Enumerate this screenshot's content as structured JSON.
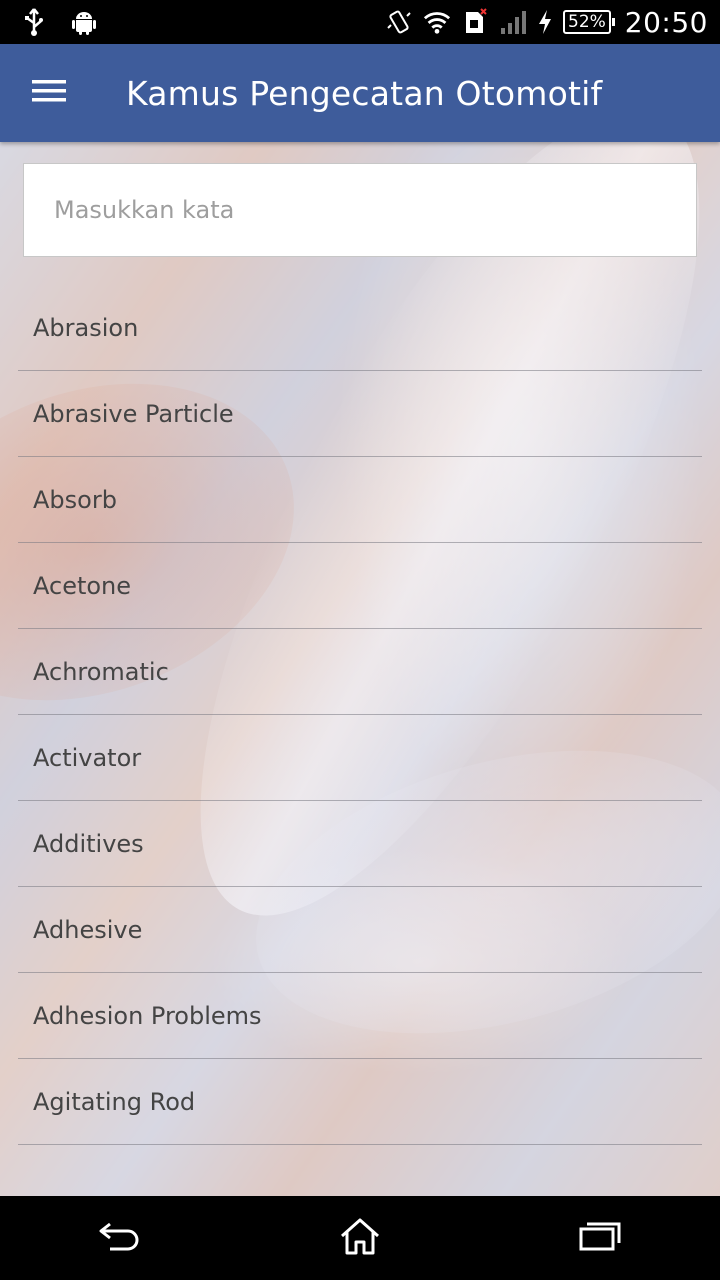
{
  "status_bar": {
    "time": "20:50",
    "battery": "52%",
    "icons": [
      "usb-icon",
      "android-icon",
      "vibrate-icon",
      "wifi-icon",
      "sim-icon",
      "signal-icon",
      "charging-icon"
    ]
  },
  "app_bar": {
    "title": "Kamus Pengecatan Otomotif",
    "menu_icon": "hamburger-menu-icon"
  },
  "search": {
    "placeholder": "Masukkan kata",
    "value": ""
  },
  "words": [
    {
      "label": "Abrasion"
    },
    {
      "label": "Abrasive Particle"
    },
    {
      "label": "Absorb"
    },
    {
      "label": "Acetone"
    },
    {
      "label": "Achromatic"
    },
    {
      "label": "Activator"
    },
    {
      "label": "Additives"
    },
    {
      "label": "Adhesive"
    },
    {
      "label": "Adhesion Problems"
    },
    {
      "label": "Agitating Rod"
    }
  ],
  "nav_bar": {
    "icons": [
      "back-icon",
      "home-icon",
      "recent-apps-icon"
    ]
  },
  "colors": {
    "app_bar": "#3e5c9b",
    "status_bar": "#000000",
    "nav_bar": "#000000"
  }
}
